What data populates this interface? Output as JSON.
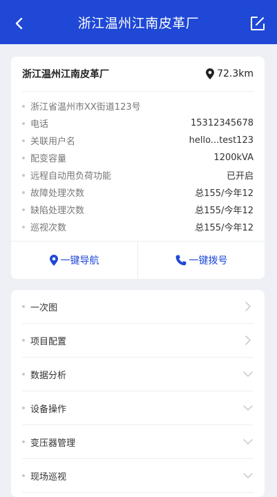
{
  "header": {
    "title": "浙江温州江南皮革厂",
    "back_icon": "back-arrow-icon",
    "edit_icon": "edit-icon"
  },
  "colors": {
    "primary": "#1f48d6",
    "background": "#eef0f5"
  },
  "info": {
    "name": "浙江温州江南皮革厂",
    "distance": "72.3km",
    "address": "浙江省温州市XX街道123号",
    "rows": [
      {
        "label": "电话",
        "value": "15312345678"
      },
      {
        "label": "关联用户名",
        "value": "hello...test123"
      },
      {
        "label": "配变容量",
        "value": "1200kVA"
      },
      {
        "label": "远程自动甩负荷功能",
        "value": "已开启"
      },
      {
        "label": "故障处理次数",
        "value": "总155/今年12"
      },
      {
        "label": "缺陷处理次数",
        "value": "总155/今年12"
      },
      {
        "label": "巡视次数",
        "value": "总155/今年12"
      }
    ],
    "actions": {
      "navigate": "一键导航",
      "call": "一键拨号"
    }
  },
  "menu": [
    {
      "label": "一次图",
      "chevron": "right"
    },
    {
      "label": "项目配置",
      "chevron": "right"
    },
    {
      "label": "数据分析",
      "chevron": "down"
    },
    {
      "label": "设备操作",
      "chevron": "down"
    },
    {
      "label": "变压器管理",
      "chevron": "down"
    },
    {
      "label": "现场巡视",
      "chevron": "down"
    }
  ]
}
